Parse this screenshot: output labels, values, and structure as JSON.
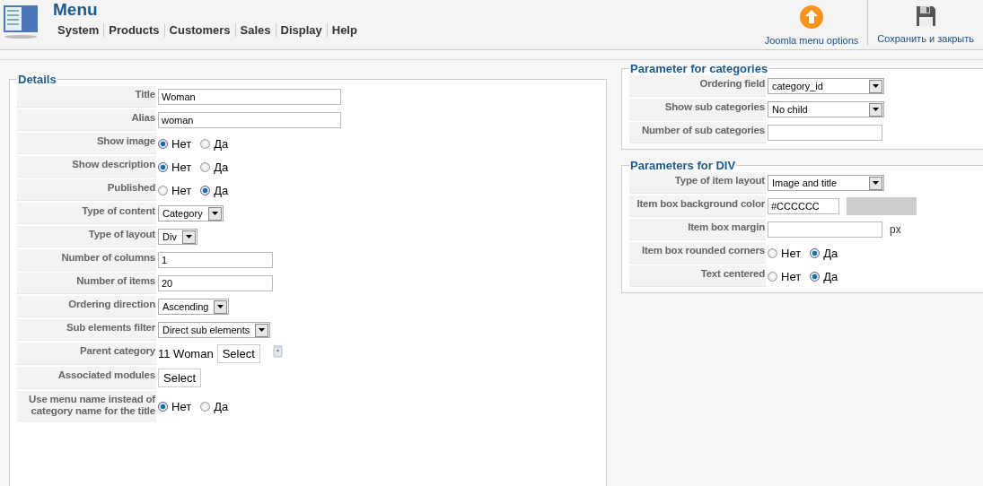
{
  "header": {
    "title": "Menu",
    "menu": [
      "System",
      "Products",
      "Customers",
      "Sales",
      "Display",
      "Help"
    ]
  },
  "toolbar": [
    {
      "kind": "options",
      "label": "Joomla menu options"
    },
    {
      "kind": "save",
      "label": "Сохранить и закрыть"
    }
  ],
  "details": {
    "legend": "Details",
    "fields": [
      {
        "kind": "text",
        "label": "Title",
        "value": "Woman"
      },
      {
        "kind": "text",
        "label": "Alias",
        "value": "woman"
      },
      {
        "kind": "radio",
        "label": "Show image",
        "options": [
          {
            "label": "Нет",
            "selected": true
          },
          {
            "label": "Да",
            "selected": false
          }
        ]
      },
      {
        "kind": "radio",
        "label": "Show description",
        "options": [
          {
            "label": "Нет",
            "selected": true
          },
          {
            "label": "Да",
            "selected": false
          }
        ]
      },
      {
        "kind": "radio",
        "label": "Published",
        "options": [
          {
            "label": "Нет",
            "selected": false
          },
          {
            "label": "Да",
            "selected": true
          }
        ]
      },
      {
        "kind": "select",
        "label": "Type of content",
        "value": "Category"
      },
      {
        "kind": "select",
        "label": "Type of layout",
        "value": "Div"
      },
      {
        "kind": "short",
        "label": "Number of columns",
        "value": "1"
      },
      {
        "kind": "short",
        "label": "Number of items",
        "value": "20"
      },
      {
        "kind": "select",
        "label": "Ordering direction",
        "value": "Ascending"
      },
      {
        "kind": "select",
        "label": "Sub elements filter",
        "value": "Direct sub elements"
      },
      {
        "kind": "picker",
        "label": "Parent category",
        "value": "11 Woman",
        "button": "Select"
      },
      {
        "kind": "button",
        "label": "Associated modules",
        "button": "Select"
      },
      {
        "kind": "radio",
        "label": "Use menu name instead of category name for the title",
        "options": [
          {
            "label": "Нет",
            "selected": true
          },
          {
            "label": "Да",
            "selected": false
          }
        ]
      }
    ]
  },
  "categories": {
    "legend": "Parameter for categories",
    "fields": [
      {
        "kind": "select",
        "label": "Ordering field",
        "value": "category_id"
      },
      {
        "kind": "select",
        "label": "Show sub categories",
        "value": "No child"
      },
      {
        "kind": "short",
        "label": "Number of sub categories"
      }
    ]
  },
  "div": {
    "legend": "Parameters for DIV",
    "fields": [
      {
        "kind": "select",
        "label": "Type of item layout",
        "value": "Image and title"
      },
      {
        "kind": "color",
        "label": "Item box background color",
        "value": "#CCCCCC"
      },
      {
        "kind": "suffix",
        "label": "Item box margin",
        "suffix": "px"
      },
      {
        "kind": "radio",
        "label": "Item box rounded corners",
        "options": [
          {
            "label": "Нет",
            "selected": false
          },
          {
            "label": "Да",
            "selected": true
          }
        ]
      },
      {
        "kind": "radio",
        "label": "Text centered",
        "options": [
          {
            "label": "Нет",
            "selected": false
          },
          {
            "label": "Да",
            "selected": true
          }
        ]
      }
    ]
  }
}
